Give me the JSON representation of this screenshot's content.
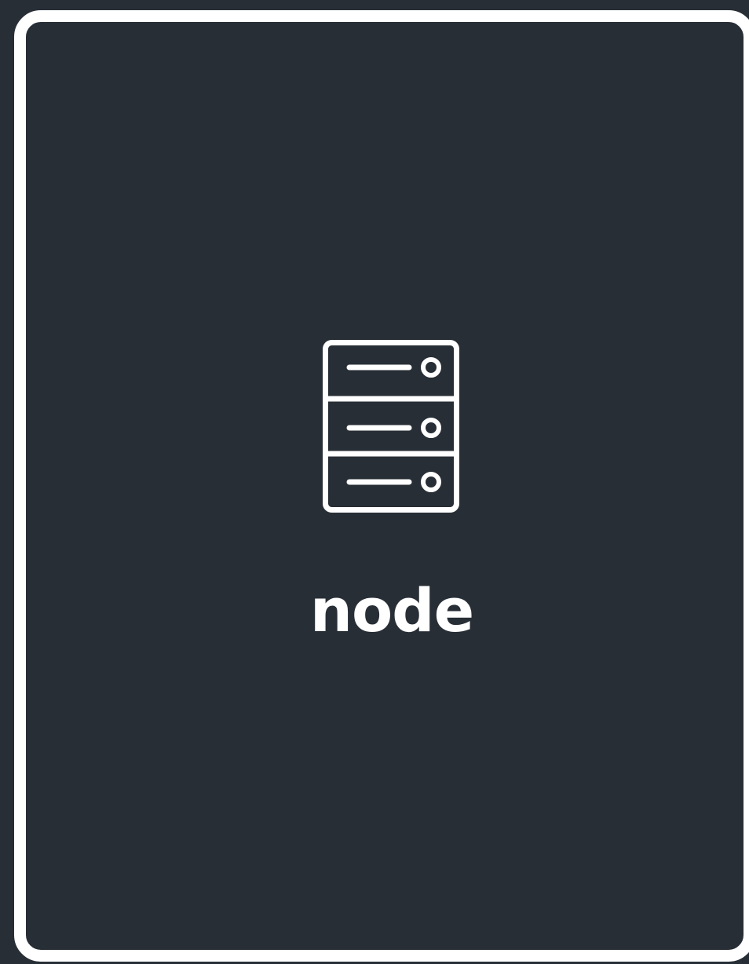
{
  "node": {
    "label": "node",
    "icon": "server-icon"
  },
  "colors": {
    "background": "#282e36",
    "foreground": "#ffffff"
  }
}
